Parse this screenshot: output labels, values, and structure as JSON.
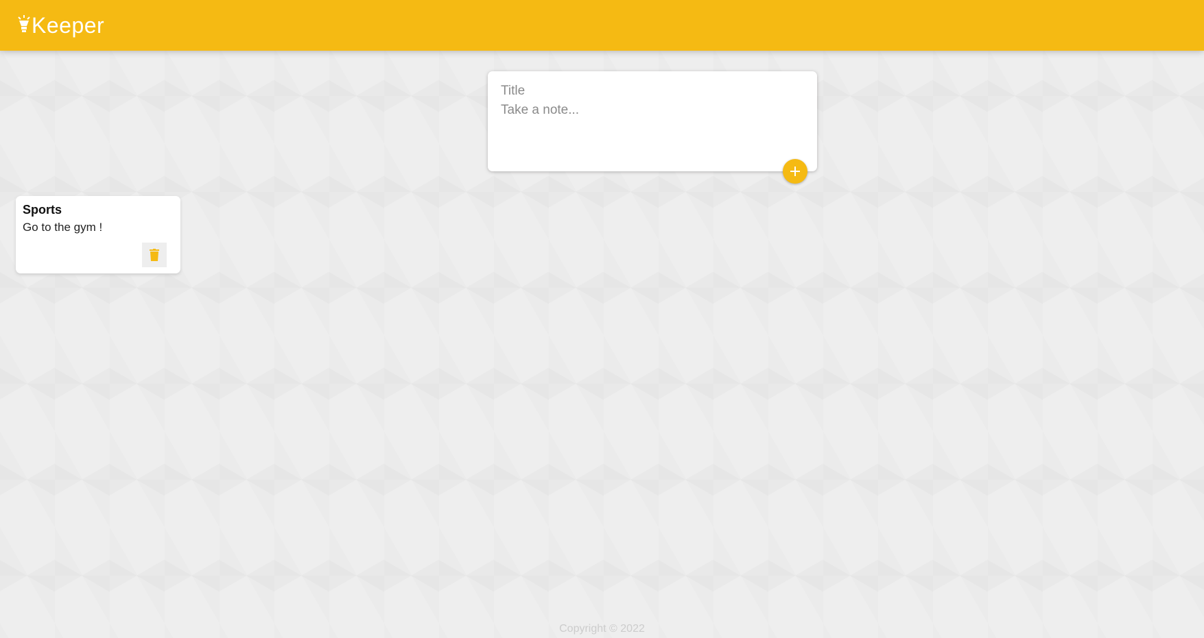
{
  "header": {
    "brand": "Keeper",
    "logo_icon": "lightbulb-icon"
  },
  "composer": {
    "title_placeholder": "Title",
    "content_placeholder": "Take a note...",
    "add_icon": "plus-icon"
  },
  "notes": [
    {
      "title": "Sports",
      "content": "Go to the gym !",
      "delete_icon": "trash-icon"
    }
  ],
  "footer": {
    "copyright": "Copyright © 2022"
  },
  "colors": {
    "accent": "#f5ba13",
    "background": "#eeeeee",
    "card": "#ffffff",
    "footer_text": "#cccccc"
  }
}
